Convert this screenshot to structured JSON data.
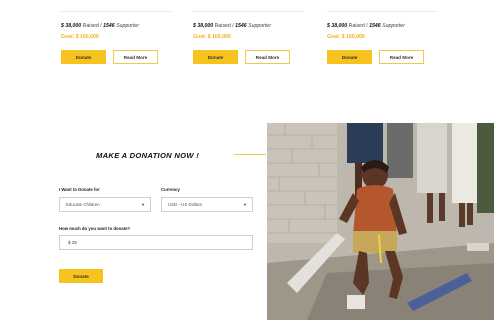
{
  "cards": [
    {
      "raised": "$ 38,000",
      "raised_suffix": "Raised",
      "supporters": "1546",
      "supporters_suffix": "Supporter",
      "goal": "Goal: $ 100,000",
      "donate_label": "Donate",
      "readmore_label": "Read More"
    },
    {
      "raised": "$ 38,000",
      "raised_suffix": "Raised",
      "supporters": "1546",
      "supporters_suffix": "Supporter",
      "goal": "Goal: $ 100,000",
      "donate_label": "Donate",
      "readmore_label": "Read More"
    },
    {
      "raised": "$ 38,000",
      "raised_suffix": "Raised",
      "supporters": "1546",
      "supporters_suffix": "Supporter",
      "goal": "Goal: $ 100,000",
      "donate_label": "Donate",
      "readmore_label": "Read More"
    }
  ],
  "donation": {
    "title": "MAKE A DONATION NOW !",
    "donate_for_label": "I Want to Donate for",
    "donate_for_value": "Educate Children",
    "currency_label": "Currency",
    "currency_value": "USD - US Dollars",
    "amount_label": "How much do you want to donate?",
    "amount_value": "$ 25",
    "submit_label": "Donate"
  },
  "colors": {
    "accent": "#f6c21d",
    "goal_text": "#f2b31a",
    "border": "#cfcfcf"
  },
  "icons": {
    "select_arrow": "caret-down-icon",
    "photo": "children-photo"
  }
}
